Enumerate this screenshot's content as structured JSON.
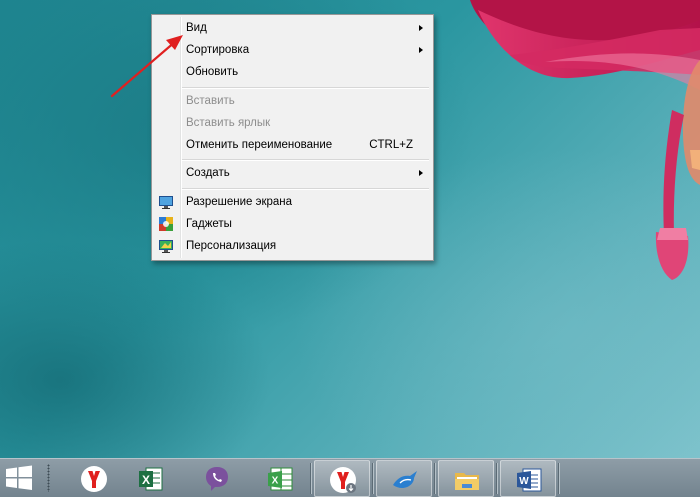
{
  "context_menu": {
    "items": [
      {
        "label": "Вид",
        "submenu": true,
        "enabled": true
      },
      {
        "label": "Сортировка",
        "submenu": true,
        "enabled": true
      },
      {
        "label": "Обновить",
        "enabled": true
      },
      {
        "label": "Вставить",
        "enabled": false
      },
      {
        "label": "Вставить ярлык",
        "enabled": false
      },
      {
        "label": "Отменить переименование",
        "shortcut": "CTRL+Z",
        "enabled": true
      },
      {
        "label": "Создать",
        "submenu": true,
        "enabled": true
      },
      {
        "label": "Разрешение экрана",
        "icon": "display-settings-icon",
        "enabled": true
      },
      {
        "label": "Гаджеты",
        "icon": "gadgets-icon",
        "enabled": true
      },
      {
        "label": "Персонализация",
        "icon": "personalization-icon",
        "enabled": true
      }
    ]
  },
  "annotation": {
    "type": "red-arrow",
    "points_to": "Вид",
    "color": "#e02020"
  },
  "taskbar": {
    "start_icon": "windows-logo-icon",
    "apps": [
      {
        "name": "yandex-browser",
        "icon": "yandex-browser-icon",
        "active": false
      },
      {
        "name": "excel-2016",
        "icon": "excel-icon",
        "active": false
      },
      {
        "name": "viber",
        "icon": "viber-icon",
        "active": false
      },
      {
        "name": "excel-2010",
        "icon": "excel-old-icon",
        "active": false
      },
      {
        "name": "yandex-browser-download",
        "icon": "yandex-browser-download-icon",
        "active": true
      },
      {
        "name": "bird-app",
        "icon": "swallow-bird-icon",
        "active": true
      },
      {
        "name": "file-explorer",
        "icon": "folder-icon",
        "active": true
      },
      {
        "name": "word",
        "icon": "word-icon",
        "active": true
      }
    ]
  },
  "colors": {
    "menu_bg": "#f1f1f1",
    "disabled_text": "#8d8d8d",
    "annotation_arrow": "#e02020"
  }
}
